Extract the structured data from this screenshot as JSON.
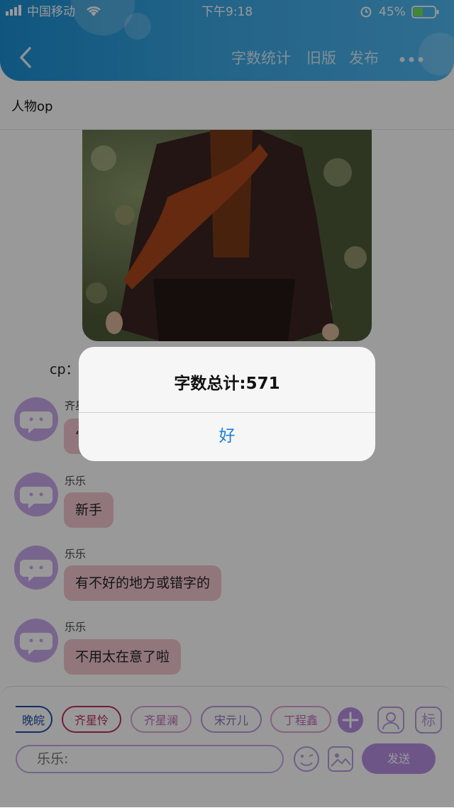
{
  "status_bar": {
    "carrier": "中国移动",
    "time": "下午9:18",
    "battery": "45%",
    "battery_level": 0.45
  },
  "nav": {
    "word_count_label": "字数统计",
    "old_version_label": "旧版",
    "publish_label": "发布"
  },
  "page": {
    "title": "人物op"
  },
  "content": {
    "cp_label": "cp："
  },
  "messages": [
    {
      "sender": "齐星",
      "text": "“"
    },
    {
      "sender": "乐乐",
      "text": "新手"
    },
    {
      "sender": "乐乐",
      "text": "有不好的地方或错字的"
    },
    {
      "sender": "乐乐",
      "text": "不用太在意了啦"
    }
  ],
  "chips": [
    "晚皖",
    "齐星怜",
    "齐星澜",
    "宋亓儿",
    "丁程鑫"
  ],
  "composer": {
    "placeholder": "乐乐:",
    "send_label": "发送",
    "tag_label": "标"
  },
  "alert": {
    "message": "字数总计:571",
    "ok_label": "好"
  },
  "colors": {
    "header_blue": "#2196d8",
    "avatar_purple": "#c9a9ec",
    "bubble_pink": "#f2c6cf",
    "alert_button_blue": "#1b7fd9"
  }
}
